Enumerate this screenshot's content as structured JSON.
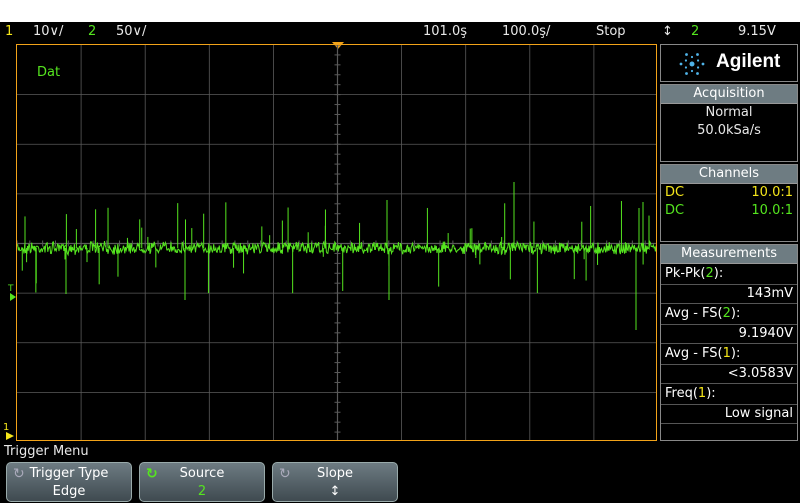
{
  "status": {
    "ch1_num": "1",
    "ch1_scale": "10∨/",
    "ch2_num": "2",
    "ch2_scale": "50∨/",
    "delay": "101.0ş",
    "timebase": "100.0ş/",
    "run_state": "Stop",
    "trig_icon": "↕",
    "trig_source": "2",
    "trig_level": "9.15V"
  },
  "screen": {
    "label": "Dat"
  },
  "brand": {
    "name": "Agilent"
  },
  "acquisition": {
    "header": "Acquisition",
    "mode": "Normal",
    "rate": "50.0kSa/s"
  },
  "channels": {
    "header": "Channels",
    "rows": [
      {
        "coupling": "DC",
        "probe": "10.0:1",
        "color": "#f5e61a"
      },
      {
        "coupling": "DC",
        "probe": "10.0:1",
        "color": "#55e51f"
      }
    ]
  },
  "measurements": {
    "header": "Measurements",
    "items": [
      {
        "label": "Pk-Pk(",
        "src": "2",
        "close": "):",
        "value": "143mV"
      },
      {
        "label": "Avg - FS(",
        "src": "2",
        "close": "):",
        "value": "9.1940V"
      },
      {
        "label": "Avg - FS(",
        "src": "1",
        "close": "):",
        "value": "<3.0583V"
      },
      {
        "label": "Freq(",
        "src": "1",
        "close": "):",
        "value": "Low signal"
      }
    ]
  },
  "menu": {
    "title": "Trigger Menu"
  },
  "softkeys": {
    "trigger_type": {
      "label": "Trigger Type",
      "value": "Edge"
    },
    "source": {
      "label": "Source",
      "value": "2"
    },
    "slope": {
      "label": "Slope",
      "value": "↕"
    }
  },
  "colors": {
    "ch1": "#f5e61a",
    "ch2": "#55e51f",
    "frame": "#f2a319",
    "grid": "#5a5a5a"
  }
}
